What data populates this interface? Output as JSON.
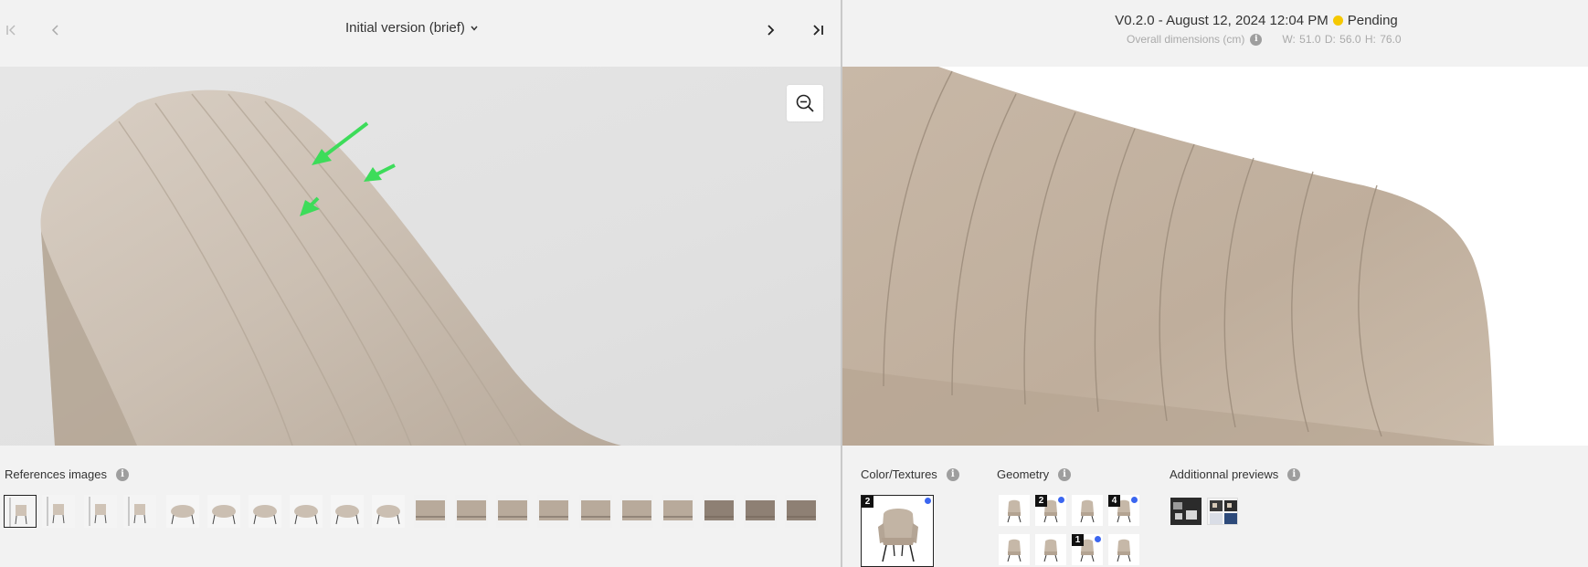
{
  "left": {
    "version_select_label": "Initial version (brief)",
    "references_label": "References images",
    "thumbnail_count": 20
  },
  "right": {
    "version_text": "V0.2.0 - August 12, 2024 12:04 PM",
    "status_text": "Pending",
    "status_color": "#f5c800",
    "dimensions_label": "Overall dimensions (cm)",
    "dimensions_values": "W: 51.0   D: 56.0   H: 76.0",
    "color_textures_label": "Color/Textures",
    "color_texture_badge": "2",
    "geometry_label": "Geometry",
    "geometry_badges": [
      "2",
      "4",
      "1"
    ],
    "additional_previews_label": "Additionnal previews"
  },
  "colors": {
    "accent_arrow": "#3ddc5a",
    "badge_dot": "#3b66f0",
    "fabric": "#c8b8a8"
  },
  "icons": [
    "first-page-icon",
    "prev-icon",
    "chevron-down-icon",
    "next-icon",
    "last-page-icon",
    "zoom-out-icon",
    "info-icon"
  ]
}
